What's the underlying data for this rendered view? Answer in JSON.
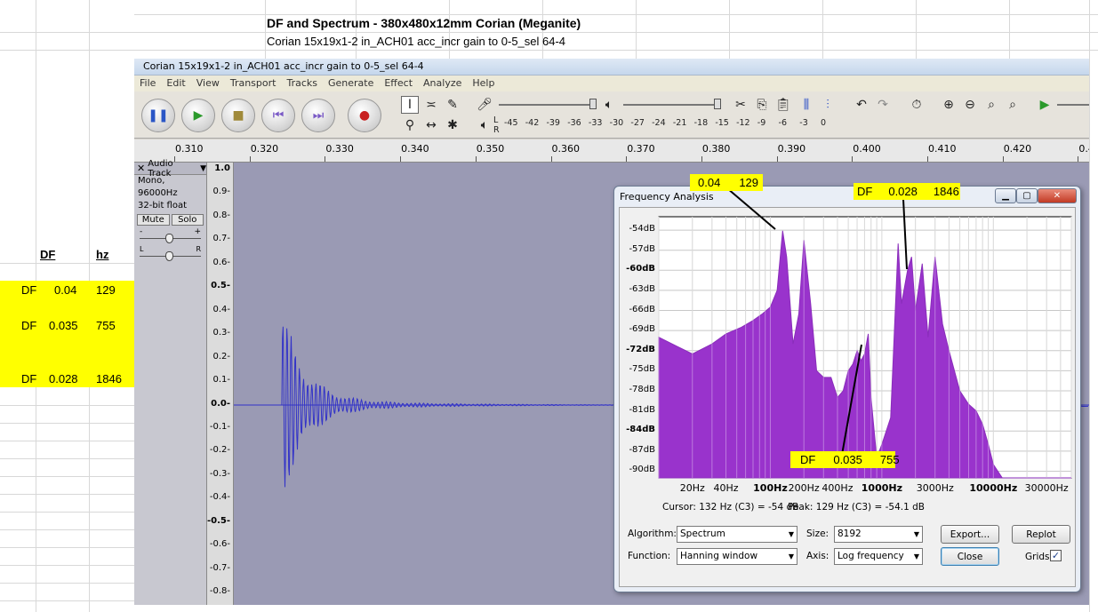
{
  "sheet": {
    "title": "DF and Spectrum - 380x480x12mm Corian (Meganite)",
    "subtitle": "Corian 15x19x1-2 in_ACH01 acc_incr gain to 0-5_sel 64-4",
    "col_df": "DF",
    "col_hz": "hz",
    "rows": [
      {
        "label": "DF",
        "df": "0.04",
        "hz": "129"
      },
      {
        "label": "DF",
        "df": "0.035",
        "hz": "755"
      },
      {
        "label": "DF",
        "df": "0.028",
        "hz": "1846"
      }
    ]
  },
  "audacity": {
    "window_title": "Corian 15x19x1-2 in_ACH01 acc_incr gain to 0-5_sel 64-4",
    "menu": [
      "File",
      "Edit",
      "View",
      "Transport",
      "Tracks",
      "Generate",
      "Effect",
      "Analyze",
      "Help"
    ],
    "meter_ticks": [
      "-45",
      "-42",
      "-39",
      "-36",
      "-33",
      "-30",
      "-27",
      "-24",
      "-21",
      "-18",
      "-15",
      "-12",
      "-9",
      "-6",
      "-3",
      "0"
    ],
    "meter_l": "L",
    "meter_r": "R",
    "ruler": [
      "0.310",
      "0.320",
      "0.330",
      "0.340",
      "0.350",
      "0.360",
      "0.370",
      "0.380",
      "0.390",
      "0.400",
      "0.410",
      "0.420",
      "0.4"
    ],
    "track": {
      "name": "Audio Track",
      "rate": "Mono, 96000Hz",
      "format": "32-bit float",
      "mute": "Mute",
      "solo": "Solo",
      "pan_l": "L",
      "pan_r": "R",
      "gain_minus": "-",
      "gain_plus": "+"
    },
    "vscale": [
      "1.0",
      "0.9-",
      "0.8-",
      "0.7-",
      "0.6-",
      "0.5-",
      "0.4-",
      "0.3-",
      "0.2-",
      "0.1-",
      "0.0-",
      "-0.1-",
      "-0.2-",
      "-0.3-",
      "-0.4-",
      "-0.5-",
      "-0.6-",
      "-0.7-",
      "-0.8-"
    ]
  },
  "freq_analysis": {
    "title": "Frequency Analysis",
    "y_labels": [
      "-54dB",
      "-57dB",
      "-60dB",
      "-63dB",
      "-66dB",
      "-69dB",
      "-72dB",
      "-75dB",
      "-78dB",
      "-81dB",
      "-84dB",
      "-87dB",
      "-90dB"
    ],
    "x_labels": [
      "20Hz",
      "40Hz",
      "100Hz",
      "200Hz",
      "400Hz",
      "1000Hz",
      "3000Hz",
      "10000Hz",
      "30000Hz"
    ],
    "cursor_text": "Cursor: 132 Hz (C3) = -54 dB",
    "peak_text": "Peak: 129 Hz (C3) = -54.1 dB",
    "algorithm_label": "Algorithm:",
    "algorithm_value": "Spectrum",
    "size_label": "Size:",
    "size_value": "8192",
    "function_label": "Function:",
    "function_value": "Hanning window",
    "axis_label": "Axis:",
    "axis_value": "Log frequency",
    "export_button": "Export...",
    "replot_button": "Replot",
    "close_button": "Close",
    "grids_label": "Grids",
    "grids_checked": true
  },
  "annotations": [
    {
      "label": "",
      "df": "0.04",
      "hz": "129"
    },
    {
      "label": "DF",
      "df": "0.028",
      "hz": "1846"
    },
    {
      "label": "DF",
      "df": "0.035",
      "hz": "755"
    }
  ],
  "chart_data": {
    "type": "area",
    "x_scale": "log",
    "xlim": [
      10,
      50000
    ],
    "ylim": [
      -91,
      -52
    ],
    "x": [
      10,
      20,
      30,
      40,
      55,
      70,
      85,
      100,
      115,
      129,
      140,
      160,
      180,
      200,
      230,
      260,
      300,
      350,
      400,
      450,
      500,
      550,
      600,
      650,
      700,
      755,
      800,
      900,
      1000,
      1200,
      1400,
      1500,
      1700,
      1846,
      2000,
      2300,
      2600,
      3000,
      3500,
      4000,
      5000,
      6000,
      7000,
      8000,
      9000,
      10000,
      12000,
      15000,
      20000,
      30000,
      50000
    ],
    "y": [
      -70,
      -72.5,
      -71,
      -69.5,
      -68.5,
      -67.5,
      -66.5,
      -65.5,
      -63,
      -54.1,
      -58,
      -71,
      -66.5,
      -55.5,
      -65,
      -75,
      -76,
      -76,
      -79,
      -78,
      -75,
      -74,
      -72,
      -73.5,
      -72.5,
      -69.5,
      -79,
      -88,
      -86,
      -82,
      -56,
      -65,
      -60,
      -58,
      -66,
      -59,
      -70,
      -58,
      -68,
      -72,
      -78,
      -80,
      -81,
      -83,
      -86,
      -89,
      -91,
      -91,
      -91,
      -91,
      -91
    ],
    "series": [
      {
        "name": "",
        "color": "#9933cc"
      }
    ]
  },
  "colors": {
    "highlight": "#ffff00",
    "spectrum_fill": "#9933cc",
    "waveform": "#3232c8"
  }
}
